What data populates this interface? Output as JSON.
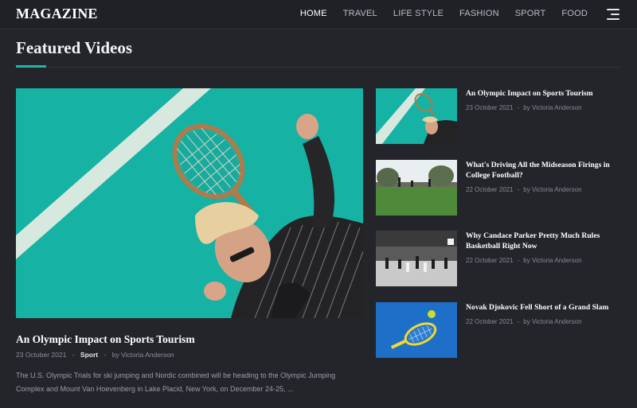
{
  "header": {
    "logo": "MAGAZINE",
    "nav": [
      {
        "label": "HOME",
        "active": true
      },
      {
        "label": "TRAVEL",
        "active": false
      },
      {
        "label": "LIFE STYLE",
        "active": false
      },
      {
        "label": "FASHION",
        "active": false
      },
      {
        "label": "SPORT",
        "active": false
      },
      {
        "label": "FOOD",
        "active": false
      }
    ],
    "menu_icon": "hamburger-icon"
  },
  "section": {
    "title": "Featured Videos",
    "accent": "#1fb6a8"
  },
  "featured": {
    "title": "An Olympic Impact on Sports Tourism",
    "date": "23 October 2021",
    "category": "Sport",
    "author": "by Victoria Anderson",
    "excerpt_line1": "The U.S. Olympic Trials for ski jumping and Nordic combined will be heading to the Olympic Jumping",
    "excerpt_line2": "Complex and Mount Van Hoevenberg in Lake Placid, New York, on December 24-25, ..."
  },
  "side_posts": [
    {
      "title": "An Olympic Impact on Sports Tourism",
      "date": "23 October 2021",
      "author": "by Victoria Anderson"
    },
    {
      "title": "What's Driving All the Midseason Firings in College Football?",
      "date": "22 October 2021",
      "author": "by Victoria Anderson"
    },
    {
      "title": "Why Candace Parker Pretty Much Rules Basketball Right Now",
      "date": "22 October 2021",
      "author": "by Victoria Anderson"
    },
    {
      "title": "Novak Djokovic Fell Short of a Grand Slam",
      "date": "22 October 2021",
      "author": "by Victoria Anderson"
    }
  ],
  "separator": "-"
}
